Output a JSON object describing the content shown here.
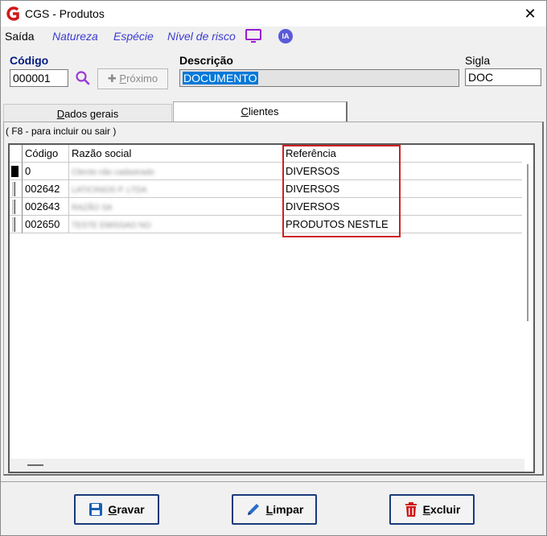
{
  "window": {
    "title": "CGS - Produtos",
    "close_glyph": "✕"
  },
  "menu": {
    "items": [
      {
        "label": "Saída",
        "style": "plain"
      },
      {
        "label": "Natureza",
        "style": "link"
      },
      {
        "label": "Espécie",
        "style": "link"
      },
      {
        "label": "Nível de risco",
        "style": "link"
      }
    ],
    "ia_badge": "IA"
  },
  "form": {
    "codigo": {
      "label": "Código",
      "value": "000001"
    },
    "proximo_button": {
      "label": "Próximo"
    },
    "descricao": {
      "label": "Descrição",
      "value": "DOCUMENTO"
    },
    "sigla": {
      "label": "Sigla",
      "value": "DOC"
    }
  },
  "tabs": [
    {
      "label": "Dados gerais",
      "active": false
    },
    {
      "label": "Clientes",
      "active": true
    }
  ],
  "hint": "( F8 - para incluir ou sair )",
  "grid": {
    "columns": [
      "Código",
      "Razão social",
      "Referência"
    ],
    "rows": [
      {
        "codigo": "0",
        "razao": "Cliente não cadastrado",
        "referencia": "DIVERSOS",
        "current": true
      },
      {
        "codigo": "002642",
        "razao": "LATICINIOS P. LTDA",
        "referencia": "DIVERSOS",
        "current": false
      },
      {
        "codigo": "002643",
        "razao": "RAZÃO SA",
        "referencia": "DIVERSOS",
        "current": false
      },
      {
        "codigo": "002650",
        "razao": "TESTE EMISSAO NO",
        "referencia": "PRODUTOS NESTLE",
        "current": false
      }
    ]
  },
  "footer": {
    "buttons": [
      {
        "label": "Gravar",
        "icon": "floppy-disk-icon",
        "color": "#1a5fb4"
      },
      {
        "label": "Limpar",
        "icon": "pencil-icon",
        "color": "#2a6ec8"
      },
      {
        "label": "Excluir",
        "icon": "trash-icon",
        "color": "#d01818"
      }
    ]
  },
  "colors": {
    "accent_blue": "#001a80",
    "link": "#3c3cd0",
    "highlight": "#cc2020",
    "selection": "#0078d7"
  }
}
